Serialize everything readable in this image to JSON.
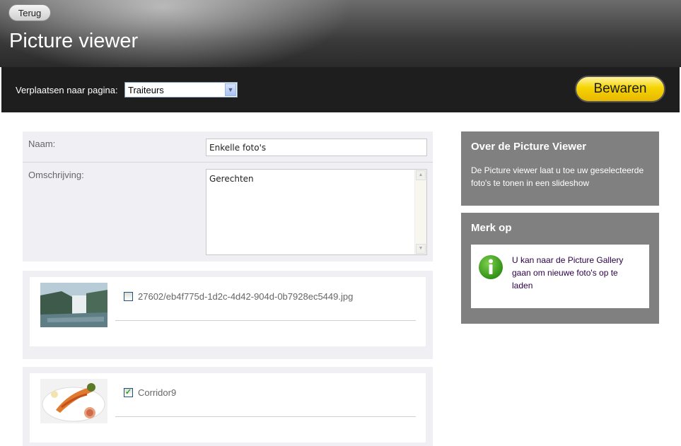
{
  "header": {
    "back_label": "Terug",
    "title": "Picture viewer"
  },
  "toolbar": {
    "move_label": "Verplaatsen naar pagina:",
    "page_select_value": "Traiteurs",
    "save_label": "Bewaren"
  },
  "form": {
    "name_label": "Naam:",
    "name_value": "Enkelle foto's",
    "description_label": "Omschrijving:",
    "description_value": "Gerechten"
  },
  "photos": [
    {
      "filename": "27602/eb4f775d-1d2c-4d42-904d-0b7928ec5449.jpg",
      "checked": false,
      "thumb_icon": "waterfall-thumbnail"
    },
    {
      "filename": "Corridor9",
      "checked": true,
      "thumb_icon": "food-plate-thumbnail"
    }
  ],
  "about_box": {
    "title": "Over de Picture Viewer",
    "text": "De Picture viewer laat u toe uw geselecteerde foto's te tonen in een slideshow"
  },
  "note_box": {
    "title": "Merk op",
    "text": "U kan naar de Picture Gallery gaan om nieuwe foto's op te laden",
    "icon": "info-icon"
  },
  "colors": {
    "toolbar_bg": "#1e1e1e",
    "save_button": "#f5d400",
    "panel_bg": "#efeff4",
    "sidebar_box_bg": "#808080",
    "info_icon_green": "#3daa1e"
  }
}
